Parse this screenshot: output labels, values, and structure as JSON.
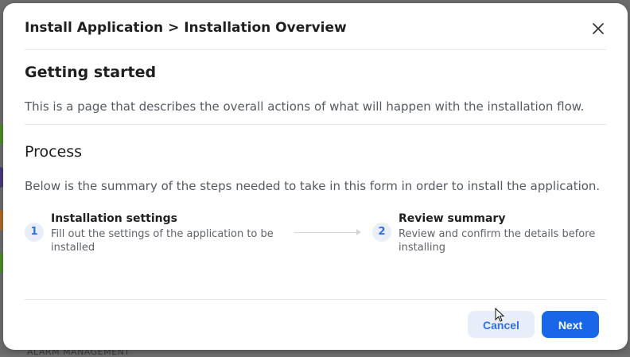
{
  "background": {
    "footer_text": "ALARM MANAGEMENT"
  },
  "modal": {
    "title": "Install Application > Installation Overview",
    "close_icon": "close-icon",
    "getting_started": {
      "heading": "Getting started",
      "text": "This is a page that describes the overall actions of what will happen with the installation flow."
    },
    "process": {
      "heading": "Process",
      "text": "Below is the summary of the steps needed to take in this form in order to install the application."
    },
    "steps": [
      {
        "number": "1",
        "title": "Installation settings",
        "description": "Fill out the settings of the application to be installed"
      },
      {
        "number": "2",
        "title": "Review summary",
        "description": "Review and confirm the details before installing"
      }
    ],
    "buttons": {
      "cancel": "Cancel",
      "next": "Next"
    }
  },
  "colors": {
    "accent": "#1a66e8",
    "accent_soft": "#e8eef9",
    "overlay": "#6f6f6f"
  }
}
